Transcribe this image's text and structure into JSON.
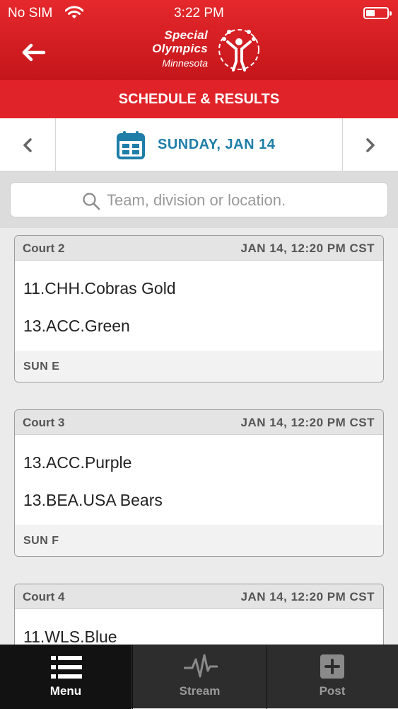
{
  "status_bar": {
    "carrier": "No SIM",
    "time": "3:22 PM"
  },
  "header": {
    "logo_line1": "Special",
    "logo_line2": "Olympics",
    "logo_line3": "Minnesota"
  },
  "title": "SCHEDULE & RESULTS",
  "date_nav": {
    "date": "SUNDAY, JAN 14"
  },
  "search": {
    "placeholder": "Team, division or location."
  },
  "games": [
    {
      "court": "Court 2",
      "time": "JAN 14, 12:20 PM CST",
      "team1": "11.CHH.Cobras Gold",
      "team2": "13.ACC.Green",
      "division": "SUN E"
    },
    {
      "court": "Court 3",
      "time": "JAN 14, 12:20 PM CST",
      "team1": "13.ACC.Purple",
      "team2": "13.BEA.USA Bears",
      "division": "SUN F"
    },
    {
      "court": "Court 4",
      "time": "JAN 14, 12:20 PM CST",
      "team1": "11.WLS.Blue",
      "team2": "",
      "division": ""
    }
  ],
  "tabs": [
    {
      "label": "Menu",
      "icon": "list-icon",
      "active": true
    },
    {
      "label": "Stream",
      "icon": "pulse-icon",
      "active": false
    },
    {
      "label": "Post",
      "icon": "plus-square-icon",
      "active": false
    }
  ],
  "colors": {
    "brand_red": "#e02329",
    "accent_blue": "#1e7ea8",
    "tabbar": "#2d2d2d"
  }
}
